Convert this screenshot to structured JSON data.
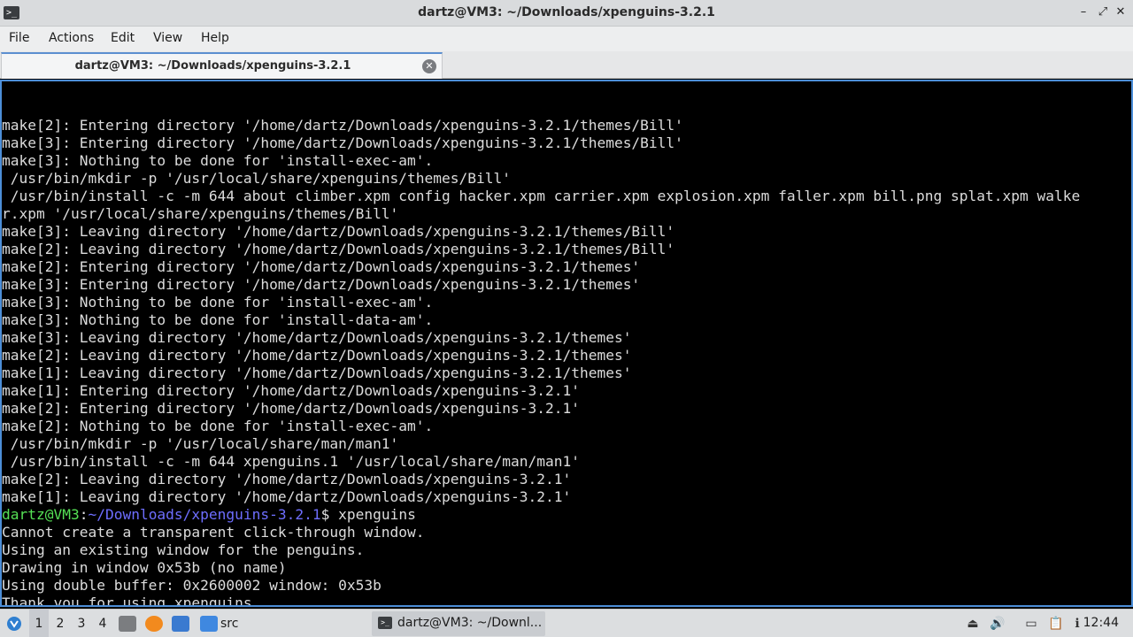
{
  "window": {
    "title": "dartz@VM3: ~/Downloads/xpenguins-3.2.1",
    "minimize_glyph": "–",
    "maximize_glyph": "⤢",
    "close_glyph": "✕"
  },
  "menu": [
    "File",
    "Actions",
    "Edit",
    "View",
    "Help"
  ],
  "tab": {
    "label": "dartz@VM3: ~/Downloads/xpenguins-3.2.1",
    "close_glyph": "✕"
  },
  "terminal": {
    "lines": [
      "make[2]: Entering directory '/home/dartz/Downloads/xpenguins-3.2.1/themes/Bill'",
      "make[3]: Entering directory '/home/dartz/Downloads/xpenguins-3.2.1/themes/Bill'",
      "make[3]: Nothing to be done for 'install-exec-am'.",
      " /usr/bin/mkdir -p '/usr/local/share/xpenguins/themes/Bill'",
      " /usr/bin/install -c -m 644 about climber.xpm config hacker.xpm carrier.xpm explosion.xpm faller.xpm bill.png splat.xpm walke",
      "r.xpm '/usr/local/share/xpenguins/themes/Bill'",
      "make[3]: Leaving directory '/home/dartz/Downloads/xpenguins-3.2.1/themes/Bill'",
      "make[2]: Leaving directory '/home/dartz/Downloads/xpenguins-3.2.1/themes/Bill'",
      "make[2]: Entering directory '/home/dartz/Downloads/xpenguins-3.2.1/themes'",
      "make[3]: Entering directory '/home/dartz/Downloads/xpenguins-3.2.1/themes'",
      "make[3]: Nothing to be done for 'install-exec-am'.",
      "make[3]: Nothing to be done for 'install-data-am'.",
      "make[3]: Leaving directory '/home/dartz/Downloads/xpenguins-3.2.1/themes'",
      "make[2]: Leaving directory '/home/dartz/Downloads/xpenguins-3.2.1/themes'",
      "make[1]: Leaving directory '/home/dartz/Downloads/xpenguins-3.2.1/themes'",
      "make[1]: Entering directory '/home/dartz/Downloads/xpenguins-3.2.1'",
      "make[2]: Entering directory '/home/dartz/Downloads/xpenguins-3.2.1'",
      "make[2]: Nothing to be done for 'install-exec-am'.",
      " /usr/bin/mkdir -p '/usr/local/share/man/man1'",
      " /usr/bin/install -c -m 644 xpenguins.1 '/usr/local/share/man/man1'",
      "make[2]: Leaving directory '/home/dartz/Downloads/xpenguins-3.2.1'",
      "make[1]: Leaving directory '/home/dartz/Downloads/xpenguins-3.2.1'"
    ],
    "prompt_user": "dartz@VM3",
    "prompt_sep": ":",
    "prompt_path": "~/Downloads/xpenguins-3.2.1",
    "prompt_symbol": "$ ",
    "command": "xpenguins",
    "output": [
      "Cannot create a transparent click-through window.",
      "Using an existing window for the penguins.",
      "Drawing in window 0x53b (no name)",
      "Using double buffer: 0x2600002 window: 0x53b",
      "Thank you for using xpenguins."
    ],
    "colors": {
      "user": "#55e055",
      "path": "#6e6eff",
      "text": "#dcdcdc",
      "accent_border": "#4c8ed8"
    }
  },
  "taskbar": {
    "desktops": [
      "1",
      "2",
      "3",
      "4"
    ],
    "active_desktop": "1",
    "folder_label": "src",
    "task_label": "dartz@VM3: ~/Downl...",
    "clock": "12:44",
    "icons": [
      "start-menu-icon",
      "file-manager-icon",
      "firefox-icon",
      "show-desktop-icon",
      "folder-icon",
      "terminal-icon",
      "eject-icon",
      "volume-icon",
      "screen-icon",
      "clipboard-icon",
      "notification-icon"
    ]
  }
}
